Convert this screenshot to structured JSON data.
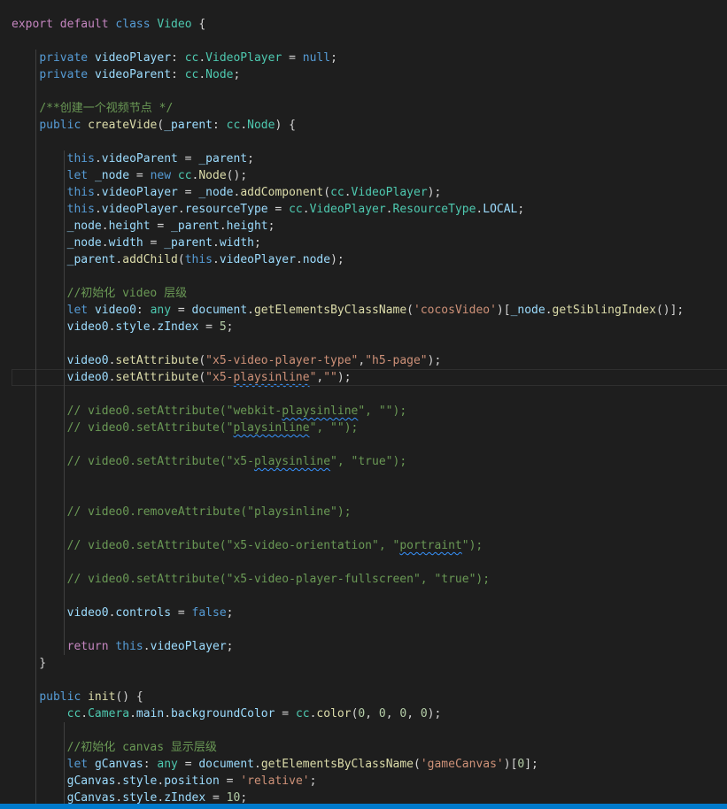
{
  "editor": {
    "colors": {
      "background": "#1e1e1e",
      "keyword_control": "#c586c0",
      "keyword_storage": "#569cd6",
      "type": "#4ec9b0",
      "variable": "#9cdcfe",
      "function": "#dcdcaa",
      "string": "#ce9178",
      "number": "#b5cea8",
      "comment": "#6a9955",
      "plain": "#d4d4d4",
      "status_bar": "#007acc"
    },
    "current_line_index": 21,
    "lines": [
      [
        [
          "kw",
          "export"
        ],
        [
          "pl",
          " "
        ],
        [
          "kw",
          "default"
        ],
        [
          "pl",
          " "
        ],
        [
          "st",
          "class"
        ],
        [
          "pl",
          " "
        ],
        [
          "ty",
          "Video"
        ],
        [
          "pl",
          " {"
        ]
      ],
      [],
      [
        [
          "pl",
          "    "
        ],
        [
          "st",
          "private"
        ],
        [
          "pl",
          " "
        ],
        [
          "vr",
          "videoPlayer"
        ],
        [
          "pl",
          ": "
        ],
        [
          "ty",
          "cc"
        ],
        [
          "pl",
          "."
        ],
        [
          "ty",
          "VideoPlayer"
        ],
        [
          "pl",
          " = "
        ],
        [
          "st",
          "null"
        ],
        [
          "pl",
          ";"
        ]
      ],
      [
        [
          "pl",
          "    "
        ],
        [
          "st",
          "private"
        ],
        [
          "pl",
          " "
        ],
        [
          "vr",
          "videoParent"
        ],
        [
          "pl",
          ": "
        ],
        [
          "ty",
          "cc"
        ],
        [
          "pl",
          "."
        ],
        [
          "ty",
          "Node"
        ],
        [
          "pl",
          ";"
        ]
      ],
      [],
      [
        [
          "pl",
          "    "
        ],
        [
          "cm",
          "/**创建一个视频节点 */"
        ]
      ],
      [
        [
          "pl",
          "    "
        ],
        [
          "st",
          "public"
        ],
        [
          "pl",
          " "
        ],
        [
          "fn",
          "createVide"
        ],
        [
          "pl",
          "("
        ],
        [
          "vr",
          "_parent"
        ],
        [
          "pl",
          ": "
        ],
        [
          "ty",
          "cc"
        ],
        [
          "pl",
          "."
        ],
        [
          "ty",
          "Node"
        ],
        [
          "pl",
          ") {"
        ]
      ],
      [],
      [
        [
          "pl",
          "        "
        ],
        [
          "st",
          "this"
        ],
        [
          "pl",
          "."
        ],
        [
          "vr",
          "videoParent"
        ],
        [
          "pl",
          " = "
        ],
        [
          "vr",
          "_parent"
        ],
        [
          "pl",
          ";"
        ]
      ],
      [
        [
          "pl",
          "        "
        ],
        [
          "st",
          "let"
        ],
        [
          "pl",
          " "
        ],
        [
          "vr",
          "_node"
        ],
        [
          "pl",
          " = "
        ],
        [
          "st",
          "new"
        ],
        [
          "pl",
          " "
        ],
        [
          "ty",
          "cc"
        ],
        [
          "pl",
          "."
        ],
        [
          "fn",
          "Node"
        ],
        [
          "pl",
          "();"
        ]
      ],
      [
        [
          "pl",
          "        "
        ],
        [
          "st",
          "this"
        ],
        [
          "pl",
          "."
        ],
        [
          "vr",
          "videoPlayer"
        ],
        [
          "pl",
          " = "
        ],
        [
          "vr",
          "_node"
        ],
        [
          "pl",
          "."
        ],
        [
          "fn",
          "addComponent"
        ],
        [
          "pl",
          "("
        ],
        [
          "ty",
          "cc"
        ],
        [
          "pl",
          "."
        ],
        [
          "ty",
          "VideoPlayer"
        ],
        [
          "pl",
          ");"
        ]
      ],
      [
        [
          "pl",
          "        "
        ],
        [
          "st",
          "this"
        ],
        [
          "pl",
          "."
        ],
        [
          "vr",
          "videoPlayer"
        ],
        [
          "pl",
          "."
        ],
        [
          "vr",
          "resourceType"
        ],
        [
          "pl",
          " = "
        ],
        [
          "ty",
          "cc"
        ],
        [
          "pl",
          "."
        ],
        [
          "ty",
          "VideoPlayer"
        ],
        [
          "pl",
          "."
        ],
        [
          "ty",
          "ResourceType"
        ],
        [
          "pl",
          "."
        ],
        [
          "vr",
          "LOCAL"
        ],
        [
          "pl",
          ";"
        ]
      ],
      [
        [
          "pl",
          "        "
        ],
        [
          "vr",
          "_node"
        ],
        [
          "pl",
          "."
        ],
        [
          "vr",
          "height"
        ],
        [
          "pl",
          " = "
        ],
        [
          "vr",
          "_parent"
        ],
        [
          "pl",
          "."
        ],
        [
          "vr",
          "height"
        ],
        [
          "pl",
          ";"
        ]
      ],
      [
        [
          "pl",
          "        "
        ],
        [
          "vr",
          "_node"
        ],
        [
          "pl",
          "."
        ],
        [
          "vr",
          "width"
        ],
        [
          "pl",
          " = "
        ],
        [
          "vr",
          "_parent"
        ],
        [
          "pl",
          "."
        ],
        [
          "vr",
          "width"
        ],
        [
          "pl",
          ";"
        ]
      ],
      [
        [
          "pl",
          "        "
        ],
        [
          "vr",
          "_parent"
        ],
        [
          "pl",
          "."
        ],
        [
          "fn",
          "addChild"
        ],
        [
          "pl",
          "("
        ],
        [
          "st",
          "this"
        ],
        [
          "pl",
          "."
        ],
        [
          "vr",
          "videoPlayer"
        ],
        [
          "pl",
          "."
        ],
        [
          "vr",
          "node"
        ],
        [
          "pl",
          ");"
        ]
      ],
      [],
      [
        [
          "pl",
          "        "
        ],
        [
          "cm",
          "//初始化 video 层级"
        ]
      ],
      [
        [
          "pl",
          "        "
        ],
        [
          "st",
          "let"
        ],
        [
          "pl",
          " "
        ],
        [
          "vr",
          "video0"
        ],
        [
          "pl",
          ": "
        ],
        [
          "ty",
          "any"
        ],
        [
          "pl",
          " = "
        ],
        [
          "vr",
          "document"
        ],
        [
          "pl",
          "."
        ],
        [
          "fn",
          "getElementsByClassName"
        ],
        [
          "pl",
          "("
        ],
        [
          "str",
          "'cocosVideo'"
        ],
        [
          "pl",
          ")["
        ],
        [
          "vr",
          "_node"
        ],
        [
          "pl",
          "."
        ],
        [
          "fn",
          "getSiblingIndex"
        ],
        [
          "pl",
          "()];"
        ]
      ],
      [
        [
          "pl",
          "        "
        ],
        [
          "vr",
          "video0"
        ],
        [
          "pl",
          "."
        ],
        [
          "vr",
          "style"
        ],
        [
          "pl",
          "."
        ],
        [
          "vr",
          "zIndex"
        ],
        [
          "pl",
          " = "
        ],
        [
          "num",
          "5"
        ],
        [
          "pl",
          ";"
        ]
      ],
      [],
      [
        [
          "pl",
          "        "
        ],
        [
          "vr",
          "video0"
        ],
        [
          "pl",
          "."
        ],
        [
          "fn",
          "setAttribute"
        ],
        [
          "pl",
          "("
        ],
        [
          "str",
          "\"x5-video-player-type\""
        ],
        [
          "pl",
          ","
        ],
        [
          "str",
          "\"h5-page\""
        ],
        [
          "pl",
          ");"
        ]
      ],
      [
        [
          "pl",
          "        "
        ],
        [
          "vr",
          "video0"
        ],
        [
          "pl",
          "."
        ],
        [
          "fn",
          "setAttribute"
        ],
        [
          "pl",
          "("
        ],
        [
          "str",
          "\"x5-"
        ],
        [
          "str",
          "playsinline",
          1
        ],
        [
          "str",
          "\""
        ],
        [
          "pl",
          ","
        ],
        [
          "str",
          "\"\""
        ],
        [
          "pl",
          ");"
        ]
      ],
      [],
      [
        [
          "pl",
          "        "
        ],
        [
          "cm",
          "// video0.setAttribute(\"webkit-"
        ],
        [
          "cm",
          "playsinline",
          1
        ],
        [
          "cm",
          "\", \"\");"
        ]
      ],
      [
        [
          "pl",
          "        "
        ],
        [
          "cm",
          "// video0.setAttribute(\""
        ],
        [
          "cm",
          "playsinline",
          1
        ],
        [
          "cm",
          "\", \"\");"
        ]
      ],
      [],
      [
        [
          "pl",
          "        "
        ],
        [
          "cm",
          "// video0.setAttribute(\"x5-"
        ],
        [
          "cm",
          "playsinline",
          1
        ],
        [
          "cm",
          "\", \"true\");"
        ]
      ],
      [],
      [],
      [
        [
          "pl",
          "        "
        ],
        [
          "cm",
          "// video0.removeAttribute(\"playsinline\");"
        ]
      ],
      [],
      [
        [
          "pl",
          "        "
        ],
        [
          "cm",
          "// video0.setAttribute(\"x5-video-orientation\", \""
        ],
        [
          "cm",
          "portraint",
          1
        ],
        [
          "cm",
          "\");"
        ]
      ],
      [],
      [
        [
          "pl",
          "        "
        ],
        [
          "cm",
          "// video0.setAttribute(\"x5-video-player-fullscreen\", \"true\");"
        ]
      ],
      [],
      [
        [
          "pl",
          "        "
        ],
        [
          "vr",
          "video0"
        ],
        [
          "pl",
          "."
        ],
        [
          "vr",
          "controls"
        ],
        [
          "pl",
          " = "
        ],
        [
          "st",
          "false"
        ],
        [
          "pl",
          ";"
        ]
      ],
      [],
      [
        [
          "pl",
          "        "
        ],
        [
          "kw",
          "return"
        ],
        [
          "pl",
          " "
        ],
        [
          "st",
          "this"
        ],
        [
          "pl",
          "."
        ],
        [
          "vr",
          "videoPlayer"
        ],
        [
          "pl",
          ";"
        ]
      ],
      [
        [
          "pl",
          "    }"
        ]
      ],
      [],
      [
        [
          "pl",
          "    "
        ],
        [
          "st",
          "public"
        ],
        [
          "pl",
          " "
        ],
        [
          "fn",
          "init"
        ],
        [
          "pl",
          "() {"
        ]
      ],
      [
        [
          "pl",
          "        "
        ],
        [
          "ty",
          "cc"
        ],
        [
          "pl",
          "."
        ],
        [
          "ty",
          "Camera"
        ],
        [
          "pl",
          "."
        ],
        [
          "vr",
          "main"
        ],
        [
          "pl",
          "."
        ],
        [
          "vr",
          "backgroundColor"
        ],
        [
          "pl",
          " = "
        ],
        [
          "ty",
          "cc"
        ],
        [
          "pl",
          "."
        ],
        [
          "fn",
          "color"
        ],
        [
          "pl",
          "("
        ],
        [
          "num",
          "0"
        ],
        [
          "pl",
          ", "
        ],
        [
          "num",
          "0"
        ],
        [
          "pl",
          ", "
        ],
        [
          "num",
          "0"
        ],
        [
          "pl",
          ", "
        ],
        [
          "num",
          "0"
        ],
        [
          "pl",
          ");"
        ]
      ],
      [],
      [
        [
          "pl",
          "        "
        ],
        [
          "cm",
          "//初始化 canvas 显示层级"
        ]
      ],
      [
        [
          "pl",
          "        "
        ],
        [
          "st",
          "let"
        ],
        [
          "pl",
          " "
        ],
        [
          "vr",
          "gCanvas"
        ],
        [
          "pl",
          ": "
        ],
        [
          "ty",
          "any"
        ],
        [
          "pl",
          " = "
        ],
        [
          "vr",
          "document"
        ],
        [
          "pl",
          "."
        ],
        [
          "fn",
          "getElementsByClassName"
        ],
        [
          "pl",
          "("
        ],
        [
          "str",
          "'gameCanvas'"
        ],
        [
          "pl",
          ")["
        ],
        [
          "num",
          "0"
        ],
        [
          "pl",
          "];"
        ]
      ],
      [
        [
          "pl",
          "        "
        ],
        [
          "vr",
          "gCanvas"
        ],
        [
          "pl",
          "."
        ],
        [
          "vr",
          "style"
        ],
        [
          "pl",
          "."
        ],
        [
          "vr",
          "position"
        ],
        [
          "pl",
          " = "
        ],
        [
          "str",
          "'relative'"
        ],
        [
          "pl",
          ";"
        ]
      ],
      [
        [
          "pl",
          "        "
        ],
        [
          "vr",
          "gCanvas"
        ],
        [
          "pl",
          "."
        ],
        [
          "vr",
          "style"
        ],
        [
          "pl",
          "."
        ],
        [
          "vr",
          "zIndex"
        ],
        [
          "pl",
          " = "
        ],
        [
          "num",
          "10"
        ],
        [
          "pl",
          ";"
        ]
      ]
    ]
  }
}
